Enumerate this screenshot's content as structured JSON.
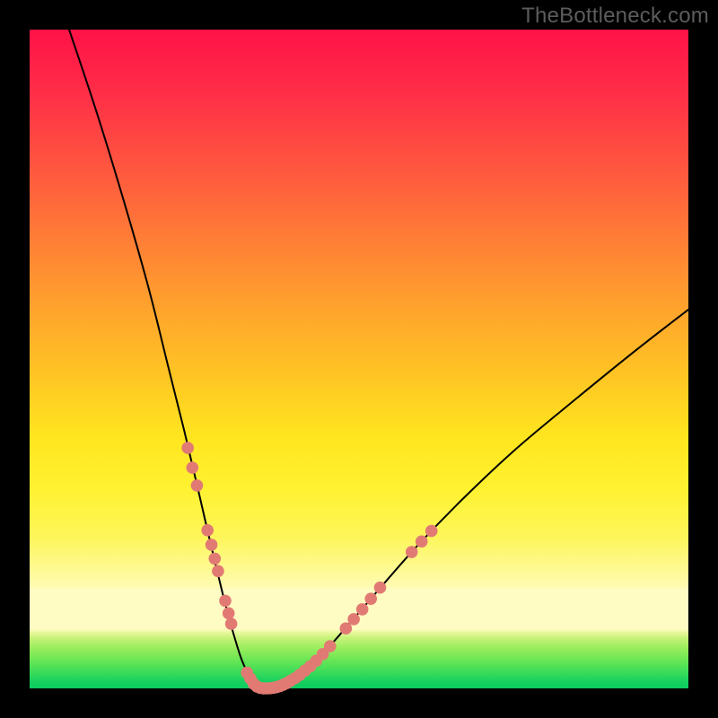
{
  "watermark": "TheBottleneck.com",
  "colors": {
    "frame": "#000000",
    "curve_main": "#000000",
    "marker_fill": "#e27a74",
    "marker_stroke": "#d86a63",
    "gradient_stops": [
      "#ff1247",
      "#ff2f47",
      "#ff5a3e",
      "#ff7e36",
      "#ffa22d",
      "#ffc324",
      "#ffe61f",
      "#fff232",
      "#fdf65a",
      "#fefbb0",
      "#fefcc2",
      "#eef9a3",
      "#c9f37a",
      "#a4ee62",
      "#7de956",
      "#55e256",
      "#2fd85b",
      "#16cf5f",
      "#0ccb61"
    ]
  },
  "chart_data": {
    "type": "line",
    "title": "",
    "xlabel": "",
    "ylabel": "",
    "xlim": [
      0,
      100
    ],
    "ylim": [
      0,
      100
    ],
    "grid": false,
    "legend": false,
    "series": [
      {
        "name": "left-branch",
        "x": [
          6,
          10,
          14,
          18,
          21,
          23.5,
          25.5,
          27,
          28.3,
          29.4,
          30.4,
          31.3,
          32.1,
          32.9,
          33.6,
          34.3
        ],
        "y": [
          100,
          88,
          75,
          61,
          49,
          39,
          30.5,
          24,
          18.5,
          14,
          10.2,
          7.1,
          4.6,
          2.7,
          1.3,
          0.35
        ]
      },
      {
        "name": "trough",
        "x": [
          34.3,
          35,
          35.8,
          36.7,
          37.7,
          38.9
        ],
        "y": [
          0.35,
          0.06,
          0,
          0.03,
          0.18,
          0.55
        ]
      },
      {
        "name": "right-branch",
        "x": [
          38.9,
          41,
          44,
          48,
          53,
          59,
          66,
          74,
          83,
          92,
          100
        ],
        "y": [
          0.55,
          1.9,
          4.7,
          9.2,
          15,
          21.8,
          29,
          36.5,
          44,
          51.3,
          57.5
        ]
      }
    ],
    "markers": {
      "name": "highlight-dots",
      "points": [
        {
          "x": 24.0,
          "y": 36.5
        },
        {
          "x": 24.7,
          "y": 33.5
        },
        {
          "x": 25.4,
          "y": 30.8
        },
        {
          "x": 27.0,
          "y": 24.0
        },
        {
          "x": 27.6,
          "y": 21.8
        },
        {
          "x": 28.1,
          "y": 19.7
        },
        {
          "x": 28.6,
          "y": 17.8
        },
        {
          "x": 29.7,
          "y": 13.3
        },
        {
          "x": 30.2,
          "y": 11.4
        },
        {
          "x": 30.6,
          "y": 9.8
        },
        {
          "x": 33.0,
          "y": 2.4
        },
        {
          "x": 33.5,
          "y": 1.5
        },
        {
          "x": 34.0,
          "y": 0.7
        },
        {
          "x": 34.5,
          "y": 0.28
        },
        {
          "x": 35.0,
          "y": 0.07
        },
        {
          "x": 35.5,
          "y": 0.01
        },
        {
          "x": 36.0,
          "y": 0.0
        },
        {
          "x": 36.5,
          "y": 0.02
        },
        {
          "x": 37.0,
          "y": 0.09
        },
        {
          "x": 37.5,
          "y": 0.2
        },
        {
          "x": 38.0,
          "y": 0.35
        },
        {
          "x": 38.5,
          "y": 0.55
        },
        {
          "x": 39.0,
          "y": 0.8
        },
        {
          "x": 39.6,
          "y": 1.15
        },
        {
          "x": 40.3,
          "y": 1.55
        },
        {
          "x": 41.0,
          "y": 2.05
        },
        {
          "x": 41.8,
          "y": 2.7
        },
        {
          "x": 42.6,
          "y": 3.35
        },
        {
          "x": 43.5,
          "y": 4.2
        },
        {
          "x": 44.5,
          "y": 5.2
        },
        {
          "x": 45.6,
          "y": 6.4
        },
        {
          "x": 48.0,
          "y": 9.1
        },
        {
          "x": 49.2,
          "y": 10.5
        },
        {
          "x": 50.5,
          "y": 12.0
        },
        {
          "x": 51.8,
          "y": 13.6
        },
        {
          "x": 53.2,
          "y": 15.3
        },
        {
          "x": 58.0,
          "y": 20.7
        },
        {
          "x": 59.5,
          "y": 22.3
        },
        {
          "x": 61.0,
          "y": 23.9
        }
      ]
    }
  }
}
